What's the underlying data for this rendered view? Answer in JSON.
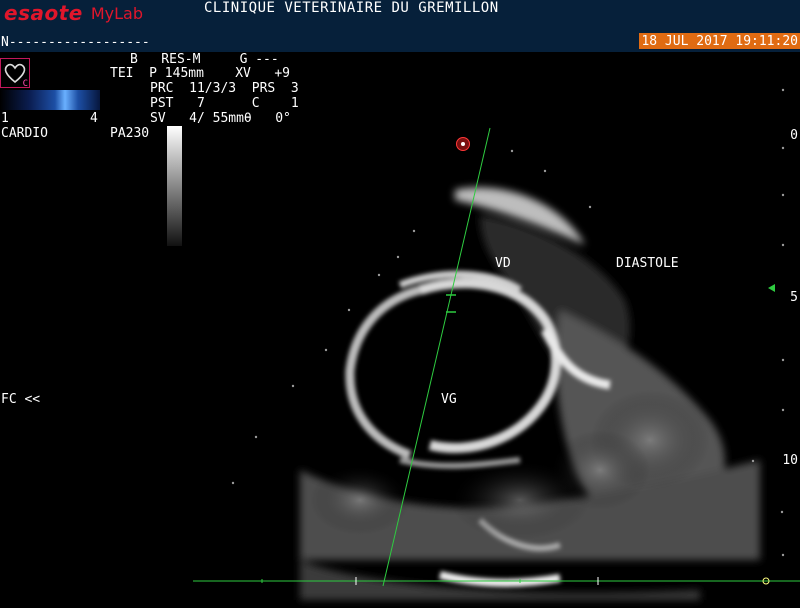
{
  "header": {
    "brand": "esaote",
    "product": "MyLab",
    "clinic": "CLINIQUE VETERINAIRE DU GREMILLON",
    "patient_line": "N------------------",
    "datetime": "18 JUL 2017 19:11:20"
  },
  "params": {
    "row1": "B   RES-M     G ---",
    "row2": "TEI  P 145mm    XV   +9",
    "row3": "PRC  11/3/3  PRS  3",
    "row4": "PST   7      C    1",
    "row5": "SV   4/ 55mmθ   0°",
    "gain_left": "1",
    "gain_right": "4",
    "mode": "CARDIO",
    "probe": "PA230",
    "heart_badge": "C"
  },
  "image_labels": {
    "vd": "VD",
    "vg": "VG",
    "phase": "DIASTOLE",
    "fc": "FC <<"
  },
  "depth_scale": [
    "0",
    "5",
    "10"
  ],
  "colors": {
    "header_bg": "#06203a",
    "date_bg": "#e06b12",
    "brand_red": "#e0162b",
    "cursor_green": "#2ecc40"
  }
}
